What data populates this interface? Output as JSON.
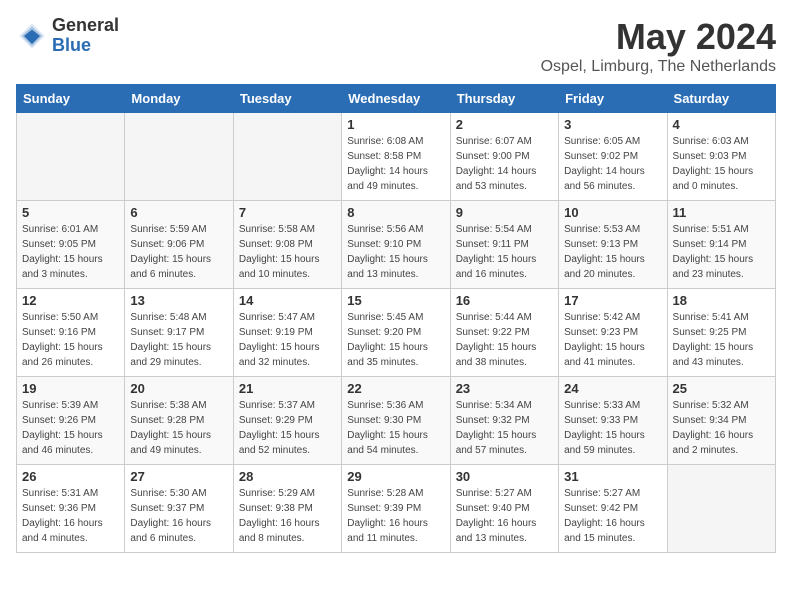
{
  "logo": {
    "general": "General",
    "blue": "Blue"
  },
  "title": "May 2024",
  "location": "Ospel, Limburg, The Netherlands",
  "weekdays": [
    "Sunday",
    "Monday",
    "Tuesday",
    "Wednesday",
    "Thursday",
    "Friday",
    "Saturday"
  ],
  "weeks": [
    [
      {
        "day": "",
        "sunrise": "",
        "sunset": "",
        "daylight": "",
        "empty": true
      },
      {
        "day": "",
        "sunrise": "",
        "sunset": "",
        "daylight": "",
        "empty": true
      },
      {
        "day": "",
        "sunrise": "",
        "sunset": "",
        "daylight": "",
        "empty": true
      },
      {
        "day": "1",
        "sunrise": "Sunrise: 6:08 AM",
        "sunset": "Sunset: 8:58 PM",
        "daylight": "Daylight: 14 hours and 49 minutes.",
        "empty": false
      },
      {
        "day": "2",
        "sunrise": "Sunrise: 6:07 AM",
        "sunset": "Sunset: 9:00 PM",
        "daylight": "Daylight: 14 hours and 53 minutes.",
        "empty": false
      },
      {
        "day": "3",
        "sunrise": "Sunrise: 6:05 AM",
        "sunset": "Sunset: 9:02 PM",
        "daylight": "Daylight: 14 hours and 56 minutes.",
        "empty": false
      },
      {
        "day": "4",
        "sunrise": "Sunrise: 6:03 AM",
        "sunset": "Sunset: 9:03 PM",
        "daylight": "Daylight: 15 hours and 0 minutes.",
        "empty": false
      }
    ],
    [
      {
        "day": "5",
        "sunrise": "Sunrise: 6:01 AM",
        "sunset": "Sunset: 9:05 PM",
        "daylight": "Daylight: 15 hours and 3 minutes.",
        "empty": false
      },
      {
        "day": "6",
        "sunrise": "Sunrise: 5:59 AM",
        "sunset": "Sunset: 9:06 PM",
        "daylight": "Daylight: 15 hours and 6 minutes.",
        "empty": false
      },
      {
        "day": "7",
        "sunrise": "Sunrise: 5:58 AM",
        "sunset": "Sunset: 9:08 PM",
        "daylight": "Daylight: 15 hours and 10 minutes.",
        "empty": false
      },
      {
        "day": "8",
        "sunrise": "Sunrise: 5:56 AM",
        "sunset": "Sunset: 9:10 PM",
        "daylight": "Daylight: 15 hours and 13 minutes.",
        "empty": false
      },
      {
        "day": "9",
        "sunrise": "Sunrise: 5:54 AM",
        "sunset": "Sunset: 9:11 PM",
        "daylight": "Daylight: 15 hours and 16 minutes.",
        "empty": false
      },
      {
        "day": "10",
        "sunrise": "Sunrise: 5:53 AM",
        "sunset": "Sunset: 9:13 PM",
        "daylight": "Daylight: 15 hours and 20 minutes.",
        "empty": false
      },
      {
        "day": "11",
        "sunrise": "Sunrise: 5:51 AM",
        "sunset": "Sunset: 9:14 PM",
        "daylight": "Daylight: 15 hours and 23 minutes.",
        "empty": false
      }
    ],
    [
      {
        "day": "12",
        "sunrise": "Sunrise: 5:50 AM",
        "sunset": "Sunset: 9:16 PM",
        "daylight": "Daylight: 15 hours and 26 minutes.",
        "empty": false
      },
      {
        "day": "13",
        "sunrise": "Sunrise: 5:48 AM",
        "sunset": "Sunset: 9:17 PM",
        "daylight": "Daylight: 15 hours and 29 minutes.",
        "empty": false
      },
      {
        "day": "14",
        "sunrise": "Sunrise: 5:47 AM",
        "sunset": "Sunset: 9:19 PM",
        "daylight": "Daylight: 15 hours and 32 minutes.",
        "empty": false
      },
      {
        "day": "15",
        "sunrise": "Sunrise: 5:45 AM",
        "sunset": "Sunset: 9:20 PM",
        "daylight": "Daylight: 15 hours and 35 minutes.",
        "empty": false
      },
      {
        "day": "16",
        "sunrise": "Sunrise: 5:44 AM",
        "sunset": "Sunset: 9:22 PM",
        "daylight": "Daylight: 15 hours and 38 minutes.",
        "empty": false
      },
      {
        "day": "17",
        "sunrise": "Sunrise: 5:42 AM",
        "sunset": "Sunset: 9:23 PM",
        "daylight": "Daylight: 15 hours and 41 minutes.",
        "empty": false
      },
      {
        "day": "18",
        "sunrise": "Sunrise: 5:41 AM",
        "sunset": "Sunset: 9:25 PM",
        "daylight": "Daylight: 15 hours and 43 minutes.",
        "empty": false
      }
    ],
    [
      {
        "day": "19",
        "sunrise": "Sunrise: 5:39 AM",
        "sunset": "Sunset: 9:26 PM",
        "daylight": "Daylight: 15 hours and 46 minutes.",
        "empty": false
      },
      {
        "day": "20",
        "sunrise": "Sunrise: 5:38 AM",
        "sunset": "Sunset: 9:28 PM",
        "daylight": "Daylight: 15 hours and 49 minutes.",
        "empty": false
      },
      {
        "day": "21",
        "sunrise": "Sunrise: 5:37 AM",
        "sunset": "Sunset: 9:29 PM",
        "daylight": "Daylight: 15 hours and 52 minutes.",
        "empty": false
      },
      {
        "day": "22",
        "sunrise": "Sunrise: 5:36 AM",
        "sunset": "Sunset: 9:30 PM",
        "daylight": "Daylight: 15 hours and 54 minutes.",
        "empty": false
      },
      {
        "day": "23",
        "sunrise": "Sunrise: 5:34 AM",
        "sunset": "Sunset: 9:32 PM",
        "daylight": "Daylight: 15 hours and 57 minutes.",
        "empty": false
      },
      {
        "day": "24",
        "sunrise": "Sunrise: 5:33 AM",
        "sunset": "Sunset: 9:33 PM",
        "daylight": "Daylight: 15 hours and 59 minutes.",
        "empty": false
      },
      {
        "day": "25",
        "sunrise": "Sunrise: 5:32 AM",
        "sunset": "Sunset: 9:34 PM",
        "daylight": "Daylight: 16 hours and 2 minutes.",
        "empty": false
      }
    ],
    [
      {
        "day": "26",
        "sunrise": "Sunrise: 5:31 AM",
        "sunset": "Sunset: 9:36 PM",
        "daylight": "Daylight: 16 hours and 4 minutes.",
        "empty": false
      },
      {
        "day": "27",
        "sunrise": "Sunrise: 5:30 AM",
        "sunset": "Sunset: 9:37 PM",
        "daylight": "Daylight: 16 hours and 6 minutes.",
        "empty": false
      },
      {
        "day": "28",
        "sunrise": "Sunrise: 5:29 AM",
        "sunset": "Sunset: 9:38 PM",
        "daylight": "Daylight: 16 hours and 8 minutes.",
        "empty": false
      },
      {
        "day": "29",
        "sunrise": "Sunrise: 5:28 AM",
        "sunset": "Sunset: 9:39 PM",
        "daylight": "Daylight: 16 hours and 11 minutes.",
        "empty": false
      },
      {
        "day": "30",
        "sunrise": "Sunrise: 5:27 AM",
        "sunset": "Sunset: 9:40 PM",
        "daylight": "Daylight: 16 hours and 13 minutes.",
        "empty": false
      },
      {
        "day": "31",
        "sunrise": "Sunrise: 5:27 AM",
        "sunset": "Sunset: 9:42 PM",
        "daylight": "Daylight: 16 hours and 15 minutes.",
        "empty": false
      },
      {
        "day": "",
        "sunrise": "",
        "sunset": "",
        "daylight": "",
        "empty": true
      }
    ]
  ]
}
